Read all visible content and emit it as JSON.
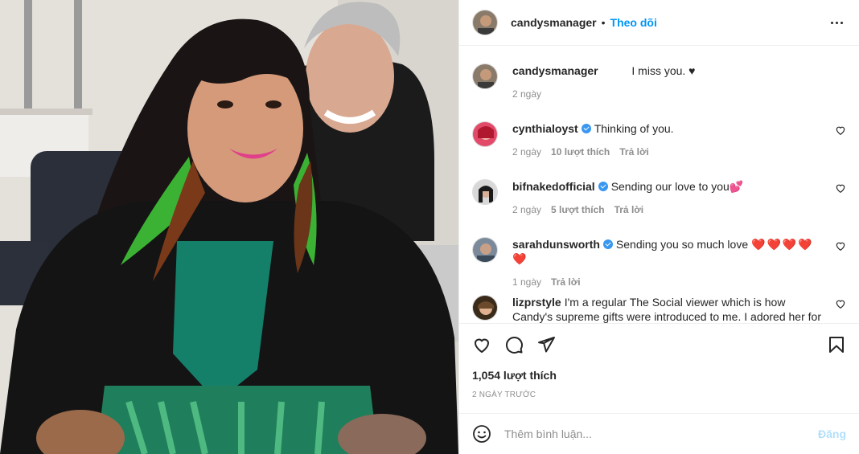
{
  "header": {
    "username": "candysmanager",
    "separator": "•",
    "follow_label": "Theo dõi"
  },
  "caption": {
    "username": "candysmanager",
    "text": "I miss you. ♥",
    "time": "2 ngày"
  },
  "comments": [
    {
      "username": "cynthialoyst",
      "verified": true,
      "text": "Thinking of you.",
      "time": "2 ngày",
      "likes": "10 lượt thích",
      "reply_label": "Trả lời"
    },
    {
      "username": "bifnakedofficial",
      "verified": true,
      "text": "Sending our love to you💕",
      "time": "2 ngày",
      "likes": "5 lượt thích",
      "reply_label": "Trả lời"
    },
    {
      "username": "sarahdunsworth",
      "verified": true,
      "text": "Sending you so much love",
      "hearts": "❤️❤️❤️❤️❤️",
      "time": "1 ngày",
      "reply_label": "Trả lời"
    },
    {
      "username": "lizprstyle",
      "verified": false,
      "text": "I'm a regular The Social viewer which is how Candy's supreme gifts were introduced to me. I adored her for both her"
    }
  ],
  "actions": {
    "likes_count": "1,054 lượt thích",
    "date": "2 NGÀY TRƯỚC"
  },
  "add_comment": {
    "placeholder": "Thêm bình luận...",
    "post_label": "Đăng"
  },
  "colors": {
    "accent": "#0095f6",
    "verified": "#3897f0",
    "heart": "#ed4956",
    "muted": "#8e8e8e"
  },
  "icons": [
    "more-icon",
    "heart-icon",
    "comment-icon",
    "share-icon",
    "bookmark-icon",
    "emoji-icon",
    "verified-icon"
  ]
}
